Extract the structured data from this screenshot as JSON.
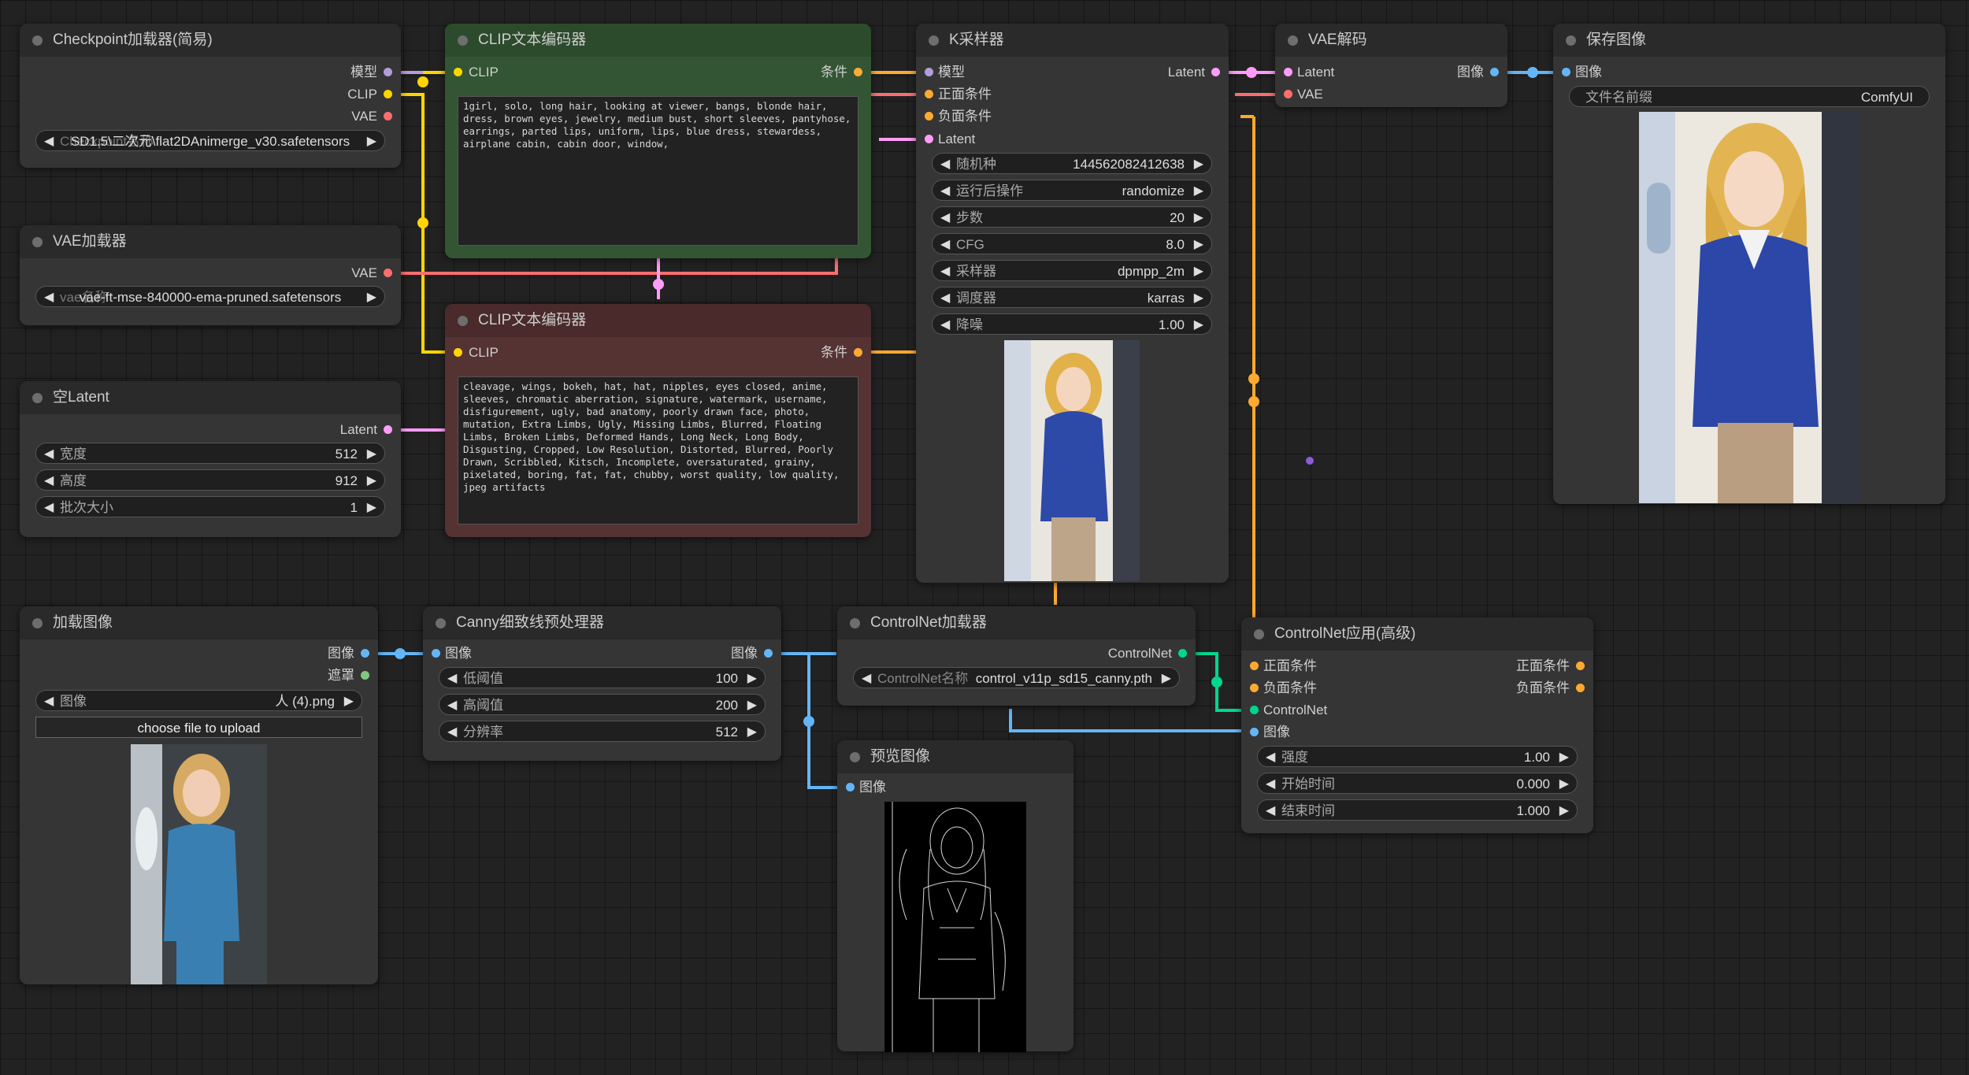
{
  "nodes": {
    "checkpoint": {
      "title": "Checkpoint加载器(简易)",
      "outputs": [
        "模型",
        "CLIP",
        "VAE"
      ],
      "ckpt_value": "SD1.5\\二次元\\flat2DAnimerge_v30.safetensors",
      "ckpt_label": "Checkpoint名称"
    },
    "vae_loader": {
      "title": "VAE加载器",
      "output": "VAE",
      "vae_label": "vae名称",
      "vae_value": "vae-ft-mse-840000-ema-pruned.safetensors"
    },
    "empty_latent": {
      "title": "空Latent",
      "output": "Latent",
      "widgets": [
        {
          "label": "宽度",
          "value": "512"
        },
        {
          "label": "高度",
          "value": "912"
        },
        {
          "label": "批次大小",
          "value": "1"
        }
      ]
    },
    "clip_pos": {
      "title": "CLIP文本编码器",
      "input": "CLIP",
      "output": "条件",
      "text": "1girl, solo, long hair, looking at viewer, bangs, blonde hair, dress, brown eyes, jewelry, medium bust, short sleeves, pantyhose, earrings, parted lips, uniform, lips, blue dress, stewardess, airplane cabin, cabin door, window,"
    },
    "clip_neg": {
      "title": "CLIP文本编码器",
      "input": "CLIP",
      "output": "条件",
      "text": "cleavage, wings, bokeh, hat, hat, nipples, eyes closed, anime, sleeves, chromatic aberration, signature, watermark, username, disfigurement, ugly, bad anatomy, poorly drawn face, photo, mutation, Extra Limbs, Ugly, Missing Limbs, Blurred, Floating Limbs, Broken Limbs, Deformed Hands, Long Neck, Long Body, Disgusting, Cropped, Low Resolution, Distorted, Blurred, Poorly Drawn, Scribbled, Kitsch, Incomplete, oversaturated, grainy, pixelated, boring, fat, fat, chubby, worst quality, low quality, jpeg artifacts"
    },
    "ksampler": {
      "title": "K采样器",
      "inputs": [
        "模型",
        "正面条件",
        "负面条件",
        "Latent"
      ],
      "output": "Latent",
      "widgets": [
        {
          "label": "随机种",
          "value": "144562082412638"
        },
        {
          "label": "运行后操作",
          "value": "randomize"
        },
        {
          "label": "步数",
          "value": "20"
        },
        {
          "label": "CFG",
          "value": "8.0"
        },
        {
          "label": "采样器",
          "value": "dpmpp_2m"
        },
        {
          "label": "调度器",
          "value": "karras"
        },
        {
          "label": "降噪",
          "value": "1.00"
        }
      ]
    },
    "vae_decode": {
      "title": "VAE解码",
      "inputs": [
        "Latent",
        "VAE"
      ],
      "output": "图像"
    },
    "save_image": {
      "title": "保存图像",
      "input": "图像",
      "prefix_label": "文件名前缀",
      "prefix_value": "ComfyUI"
    },
    "load_image": {
      "title": "加载图像",
      "outputs": [
        "图像",
        "遮罩"
      ],
      "image_label": "图像",
      "image_value": "人 (4).png",
      "upload_label": "choose file to upload"
    },
    "canny": {
      "title": "Canny细致线预处理器",
      "input": "图像",
      "output": "图像",
      "widgets": [
        {
          "label": "低阈值",
          "value": "100"
        },
        {
          "label": "高阈值",
          "value": "200"
        },
        {
          "label": "分辨率",
          "value": "512"
        }
      ]
    },
    "controlnet_loader": {
      "title": "ControlNet加载器",
      "output": "ControlNet",
      "name_label": "ControlNet名称",
      "name_value": "control_v11p_sd15_canny.pth"
    },
    "preview": {
      "title": "预览图像",
      "input": "图像"
    },
    "controlnet_apply": {
      "title": "ControlNet应用(高级)",
      "inputs": [
        "正面条件",
        "负面条件",
        "ControlNet",
        "图像"
      ],
      "outputs": [
        "正面条件",
        "负面条件"
      ],
      "widgets": [
        {
          "label": "强度",
          "value": "1.00"
        },
        {
          "label": "开始时间",
          "value": "0.000"
        },
        {
          "label": "结束时间",
          "value": "1.000"
        }
      ]
    }
  },
  "colors": {
    "model": "#b39ddb",
    "clip": "#ffd500",
    "vae": "#ff6e6e",
    "latent": "#ff9cf9",
    "image": "#64b5f6",
    "conditioning": "#ffa931",
    "mask": "#81c784",
    "controlnet": "#00d78d"
  }
}
